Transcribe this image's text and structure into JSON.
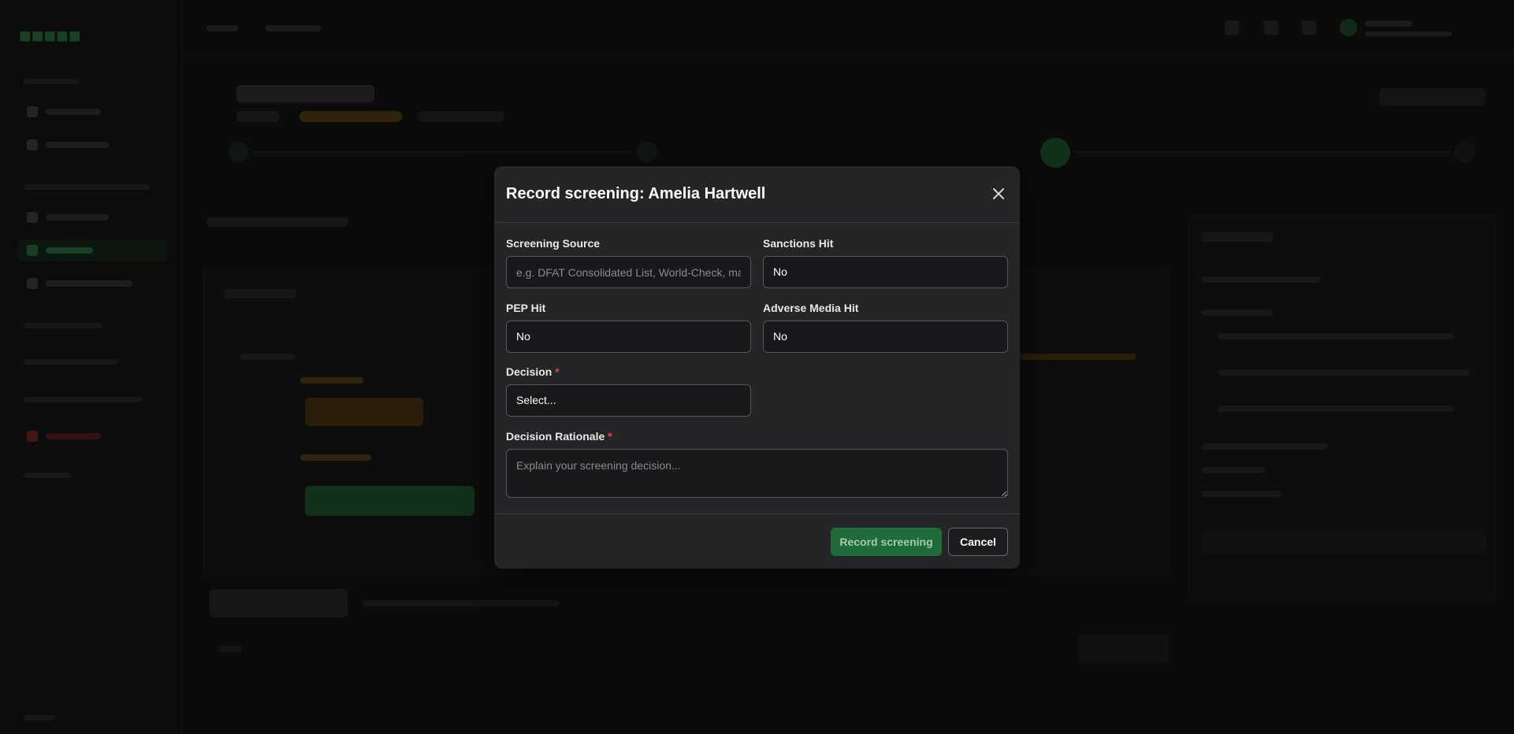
{
  "modal": {
    "title": "Record screening: Amelia Hartwell",
    "fields": {
      "screening_source": {
        "label": "Screening Source",
        "value": "",
        "placeholder": "e.g. DFAT Consolidated List, World-Check, manual search"
      },
      "sanctions_hit": {
        "label": "Sanctions Hit",
        "value": "No"
      },
      "pep_hit": {
        "label": "PEP Hit",
        "value": "No"
      },
      "adverse_media_hit": {
        "label": "Adverse Media Hit",
        "value": "No"
      },
      "decision": {
        "label": "Decision",
        "required_mark": "*",
        "value": "Select..."
      },
      "decision_rationale": {
        "label": "Decision Rationale",
        "required_mark": "*",
        "value": "",
        "placeholder": "Explain your screening decision..."
      }
    },
    "footer": {
      "primary_label": "Record screening",
      "cancel_label": "Cancel"
    }
  },
  "colors": {
    "accent": "#1f6b3a",
    "required": "#e04848",
    "overlay": "rgba(0,0,0,0.6)"
  }
}
